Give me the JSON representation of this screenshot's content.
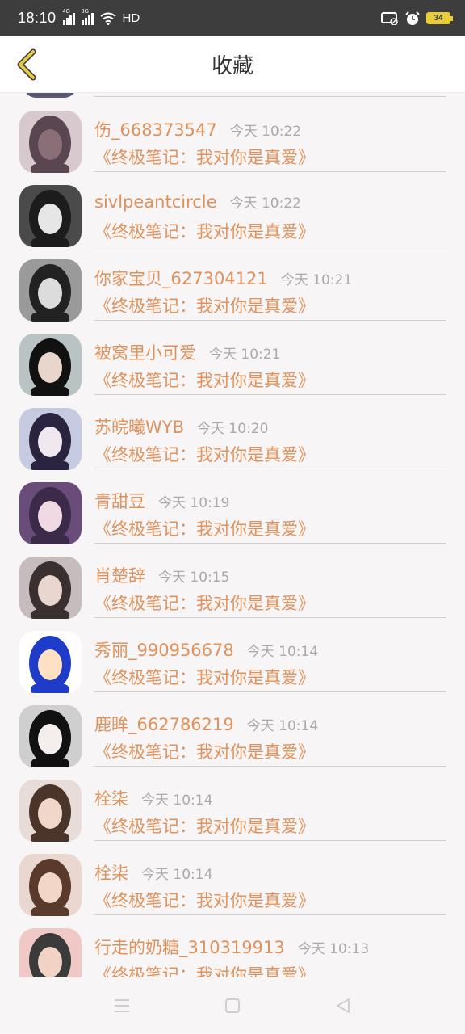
{
  "status_bar": {
    "time": "18:10",
    "net1": "4G",
    "net2": "3G",
    "hd": "HD",
    "battery": "34"
  },
  "header": {
    "title": "收藏"
  },
  "items": [
    {
      "name": "伤_668373547",
      "time": "今天 10:22",
      "title": "《终极笔记：我对你是真爱》"
    },
    {
      "name": "sivlpeantcircle",
      "time": "今天 10:22",
      "title": "《终极笔记：我对你是真爱》"
    },
    {
      "name": "你家宝贝_627304121",
      "time": "今天 10:21",
      "title": "《终极笔记：我对你是真爱》"
    },
    {
      "name": "被窝里小可爱",
      "time": "今天 10:21",
      "title": "《终极笔记：我对你是真爱》"
    },
    {
      "name": "苏皖曦WYB",
      "time": "今天 10:20",
      "title": "《终极笔记：我对你是真爱》"
    },
    {
      "name": "青甜豆",
      "time": "今天 10:19",
      "title": "《终极笔记：我对你是真爱》"
    },
    {
      "name": "肖楚辞",
      "time": "今天 10:15",
      "title": "《终极笔记：我对你是真爱》"
    },
    {
      "name": "秀丽_990956678",
      "time": "今天 10:14",
      "title": "《终极笔记：我对你是真爱》"
    },
    {
      "name": "鹿眸_662786219",
      "time": "今天 10:14",
      "title": "《终极笔记：我对你是真爱》"
    },
    {
      "name": "栓柒",
      "time": "今天 10:14",
      "title": "《终极笔记：我对你是真爱》"
    },
    {
      "name": "栓柒",
      "time": "今天 10:14",
      "title": "《终极笔记：我对你是真爱》"
    },
    {
      "name": "行走的奶糖_310319913",
      "time": "今天 10:13",
      "title": "《终极笔记：我对你是真爱》"
    }
  ],
  "colors": {
    "accent": "#e0925c",
    "back_arrow": "#e8c84a",
    "time_text": "#aaaaaa"
  },
  "icons": {
    "back": "back-arrow-icon",
    "nav": [
      "menu-icon",
      "home-icon",
      "back-triangle-icon"
    ]
  }
}
